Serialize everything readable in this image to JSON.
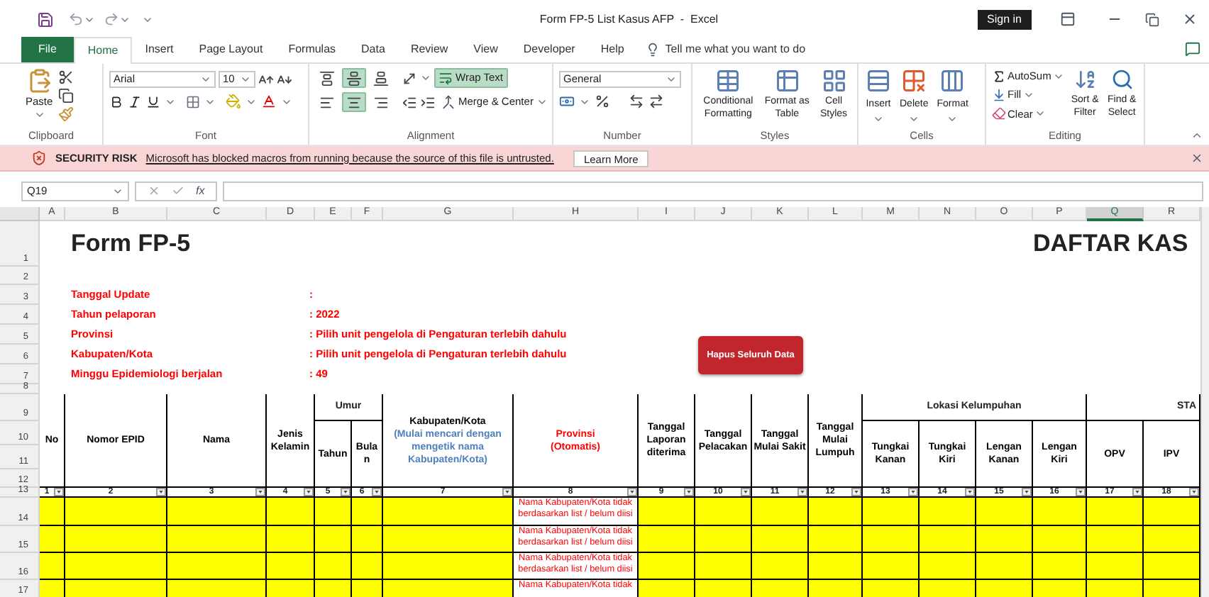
{
  "window": {
    "title": "Form FP-5 List Kasus AFP  -  Excel",
    "sign_in": "Sign in"
  },
  "ribbon_tabs": [
    {
      "label": "File",
      "kind": "file",
      "selected": false
    },
    {
      "label": "Home",
      "kind": "tab",
      "selected": true
    },
    {
      "label": "Insert",
      "kind": "tab",
      "selected": false
    },
    {
      "label": "Page Layout",
      "kind": "tab",
      "selected": false
    },
    {
      "label": "Formulas",
      "kind": "tab",
      "selected": false
    },
    {
      "label": "Data",
      "kind": "tab",
      "selected": false
    },
    {
      "label": "Review",
      "kind": "tab",
      "selected": false
    },
    {
      "label": "View",
      "kind": "tab",
      "selected": false
    },
    {
      "label": "Developer",
      "kind": "tab",
      "selected": false
    },
    {
      "label": "Help",
      "kind": "tab",
      "selected": false
    }
  ],
  "tell_me": {
    "placeholder": "Tell me what you want to do"
  },
  "ribbon": {
    "clipboard": {
      "label": "Clipboard",
      "paste": "Paste"
    },
    "font": {
      "label": "Font",
      "font_name": "Arial",
      "font_size": "10"
    },
    "alignment": {
      "label": "Alignment",
      "vertical": [
        {
          "selected": false
        },
        {
          "selected": true
        },
        {
          "selected": false
        }
      ],
      "horizontal": [
        {
          "selected": false
        },
        {
          "selected": true
        },
        {
          "selected": false
        }
      ],
      "wrap_text": {
        "label": "Wrap Text",
        "on": true
      },
      "merge": {
        "label": "Merge & Center"
      }
    },
    "number": {
      "label": "Number",
      "format": "General"
    },
    "styles": {
      "label": "Styles",
      "buttons": [
        "Conditional Formatting",
        "Format as Table",
        "Cell Styles"
      ]
    },
    "cells": {
      "label": "Cells",
      "buttons": [
        "Insert",
        "Delete",
        "Format"
      ]
    },
    "editing": {
      "label": "Editing",
      "autosum": "AutoSum",
      "fill": "Fill",
      "clear": "Clear",
      "sort": "Sort & Filter",
      "find": "Find & Select"
    }
  },
  "security_bar": {
    "title": "SECURITY RISK",
    "message": "Microsoft has blocked macros from running because the source of this file is untrusted.",
    "button": "Learn More"
  },
  "formula_bar": {
    "name_box": "Q19",
    "fx": "fx"
  },
  "sheet": {
    "columns": [
      {
        "label": "A",
        "selected": false
      },
      {
        "label": "B",
        "selected": false
      },
      {
        "label": "C",
        "selected": false
      },
      {
        "label": "D",
        "selected": false
      },
      {
        "label": "E",
        "selected": false
      },
      {
        "label": "F",
        "selected": false
      },
      {
        "label": "G",
        "selected": false
      },
      {
        "label": "H",
        "selected": false
      },
      {
        "label": "I",
        "selected": false
      },
      {
        "label": "J",
        "selected": false
      },
      {
        "label": "K",
        "selected": false
      },
      {
        "label": "L",
        "selected": false
      },
      {
        "label": "M",
        "selected": false
      },
      {
        "label": "N",
        "selected": false
      },
      {
        "label": "O",
        "selected": false
      },
      {
        "label": "P",
        "selected": false
      },
      {
        "label": "Q",
        "selected": true
      },
      {
        "label": "R",
        "selected": false
      }
    ],
    "row_numbers": [
      "1",
      "2",
      "3",
      "4",
      "5",
      "6",
      "7",
      "8",
      "9",
      "10",
      "11",
      "12",
      "13",
      "14",
      "15",
      "16",
      "17"
    ],
    "title": "Form FP-5",
    "title_right": "DAFTAR KAS",
    "info": [
      {
        "label": "Tanggal Update",
        "value": ":"
      },
      {
        "label": "Tahun pelaporan",
        "value": ": 2022"
      },
      {
        "label": "Provinsi",
        "value": ": Pilih unit pengelola di Pengaturan terlebih dahulu"
      },
      {
        "label": "Kabupaten/Kota",
        "value": ": Pilih unit pengelola di Pengaturan terlebih dahulu"
      },
      {
        "label": "Minggu Epidemiologi berjalan",
        "value": ": 49"
      }
    ],
    "button": "Hapus Seluruh Data",
    "headers": [
      {
        "text": "No"
      },
      {
        "text": "Nomor EPID"
      },
      {
        "text": "Nama"
      },
      {
        "text": "Jenis Kelamin"
      },
      {
        "group": "Umur",
        "children": [
          {
            "text": "Tahun"
          },
          {
            "text": "Bulan"
          }
        ]
      },
      {
        "text": "Kabupaten/Kota",
        "note": "(Mulai mencari dengan mengetik nama Kabupaten/Kota)",
        "kind": "input"
      },
      {
        "text": "Provinsi",
        "note": "(Otomatis)",
        "kind": "auto"
      },
      {
        "text": "Tanggal Laporan diterima"
      },
      {
        "text": "Tanggal Pelacakan"
      },
      {
        "text": "Tanggal Mulai Sakit"
      },
      {
        "text": "Tanggal Mulai Lumpuh"
      },
      {
        "group": "Lokasi Kelumpuhan",
        "children": [
          {
            "text": "Tungkai Kanan"
          },
          {
            "text": "Tungkai Kiri"
          },
          {
            "text": "Lengan Kanan"
          },
          {
            "text": "Lengan Kiri"
          }
        ]
      },
      {
        "group": "STA",
        "children": [
          {
            "text": "OPV"
          },
          {
            "text": "IPV"
          }
        ]
      }
    ],
    "filter_numbers": [
      "1",
      "2",
      "3",
      "4",
      "5",
      "6",
      "7",
      "8",
      "9",
      "10",
      "11",
      "12",
      "13",
      "14",
      "15",
      "16",
      "17",
      "18"
    ],
    "data_rows": [
      {
        "provinsi": "Nama Kabupaten/Kota tidak berdasarkan list / belum diisi"
      },
      {
        "provinsi": "Nama Kabupaten/Kota tidak berdasarkan list / belum diisi"
      },
      {
        "provinsi": "Nama Kabupaten/Kota tidak berdasarkan list / belum diisi"
      },
      {
        "provinsi": "Nama Kabupaten/Kota tidak"
      }
    ]
  }
}
